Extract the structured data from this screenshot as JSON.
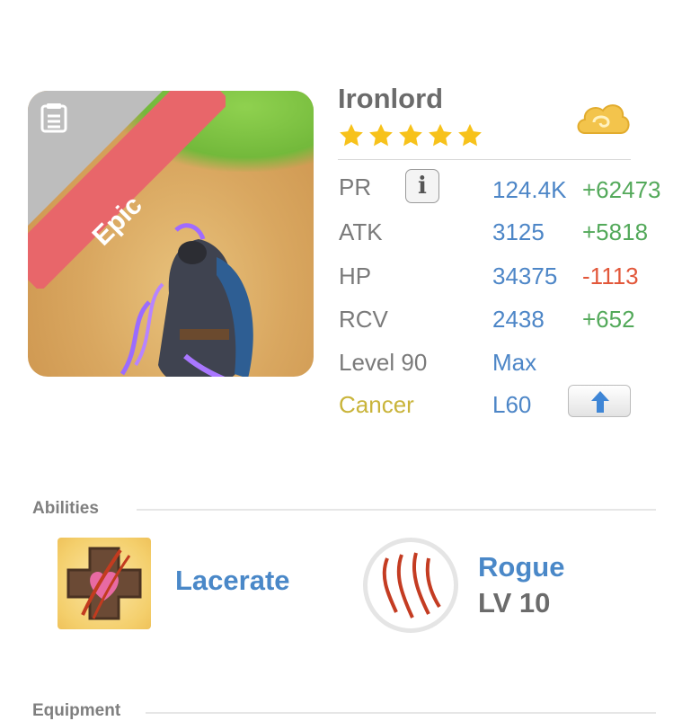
{
  "hero": {
    "name": "Ironlord",
    "rarity": "Epic",
    "star_count": 5,
    "element_icon": "cancer-zodiac-icon"
  },
  "stats": {
    "pr": {
      "label": "PR",
      "value": "124.4K",
      "delta": "+62473"
    },
    "atk": {
      "label": "ATK",
      "value": "3125",
      "delta": "+5818"
    },
    "hp": {
      "label": "HP",
      "value": "34375",
      "delta": "-1113"
    },
    "rcv": {
      "label": "RCV",
      "value": "2438",
      "delta": "+652"
    },
    "level": {
      "label": "Level 90",
      "value": "Max"
    },
    "sign": {
      "label": "Cancer",
      "value": "L60"
    }
  },
  "sections": {
    "abilities_title": "Abilities",
    "equipment_title": "Equipment"
  },
  "ability": {
    "name": "Lacerate"
  },
  "class": {
    "name": "Rogue",
    "level": "LV 10"
  },
  "colors": {
    "accent_blue": "#4a88c8",
    "positive": "#53a95a",
    "negative": "#e2573a",
    "cancer_gold": "#c9b43a",
    "epic_ribbon": "#e8666a",
    "star": "#f7c21b"
  }
}
